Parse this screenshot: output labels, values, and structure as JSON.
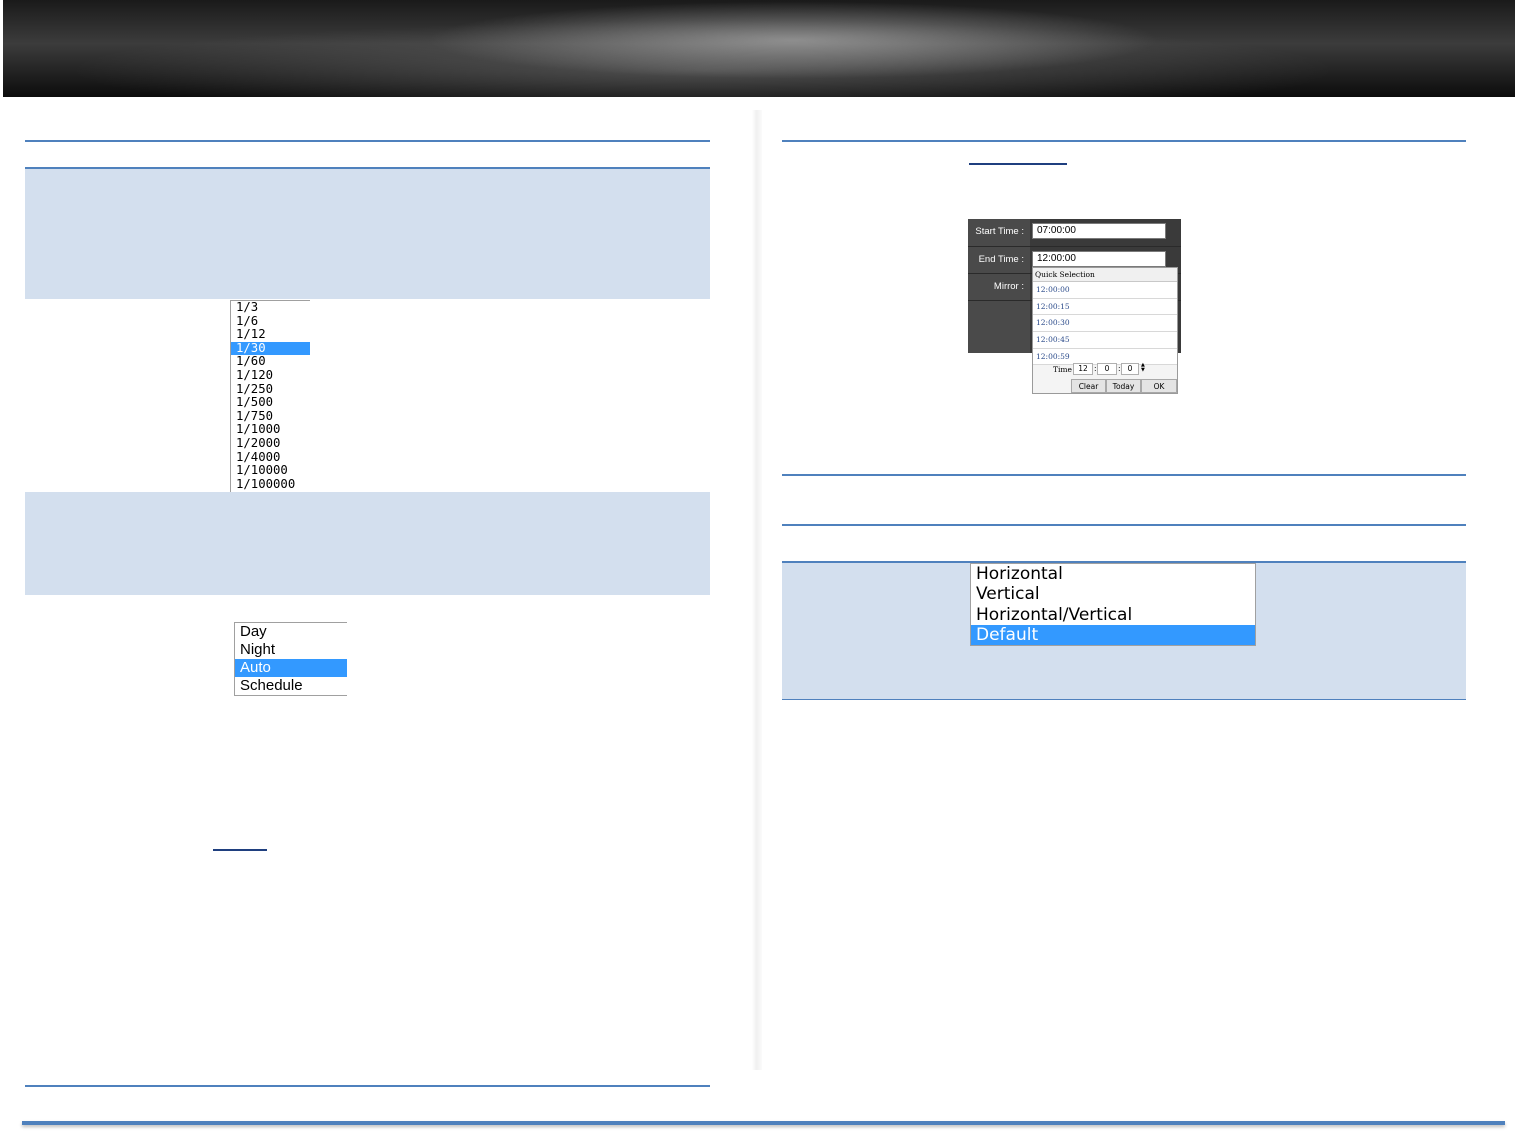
{
  "shutter": {
    "options": [
      "1/3",
      "1/6",
      "1/12",
      "1/30",
      "1/60",
      "1/120",
      "1/250",
      "1/500",
      "1/750",
      "1/1000",
      "1/2000",
      "1/4000",
      "1/10000",
      "1/100000"
    ],
    "selected_index": 3
  },
  "day_night": {
    "options": [
      "Day",
      "Night",
      "Auto",
      "Schedule"
    ],
    "selected_index": 2
  },
  "schedule": {
    "start_label": "Start Time :",
    "start_value": "07:00:00",
    "end_label": "End Time :",
    "end_value": "12:00:00",
    "mirror_label": "Mirror :",
    "quick_selection_title": "Quick Selection",
    "quick_times": [
      "12:00:00",
      "12:00:15",
      "12:00:30",
      "12:00:45",
      "12:00:59"
    ],
    "time_label": "Time",
    "hour": "12",
    "minute": "0",
    "second": "0",
    "clear_label": "Clear",
    "today_label": "Today",
    "ok_label": "OK"
  },
  "mirror": {
    "options": [
      "Horizontal",
      "Vertical",
      "Horizontal/Vertical",
      "Default"
    ],
    "selected_index": 3
  },
  "colors": {
    "accent_line": "#4f81bd",
    "panel_bg": "#d3dfee",
    "selection": "#3399ff"
  }
}
